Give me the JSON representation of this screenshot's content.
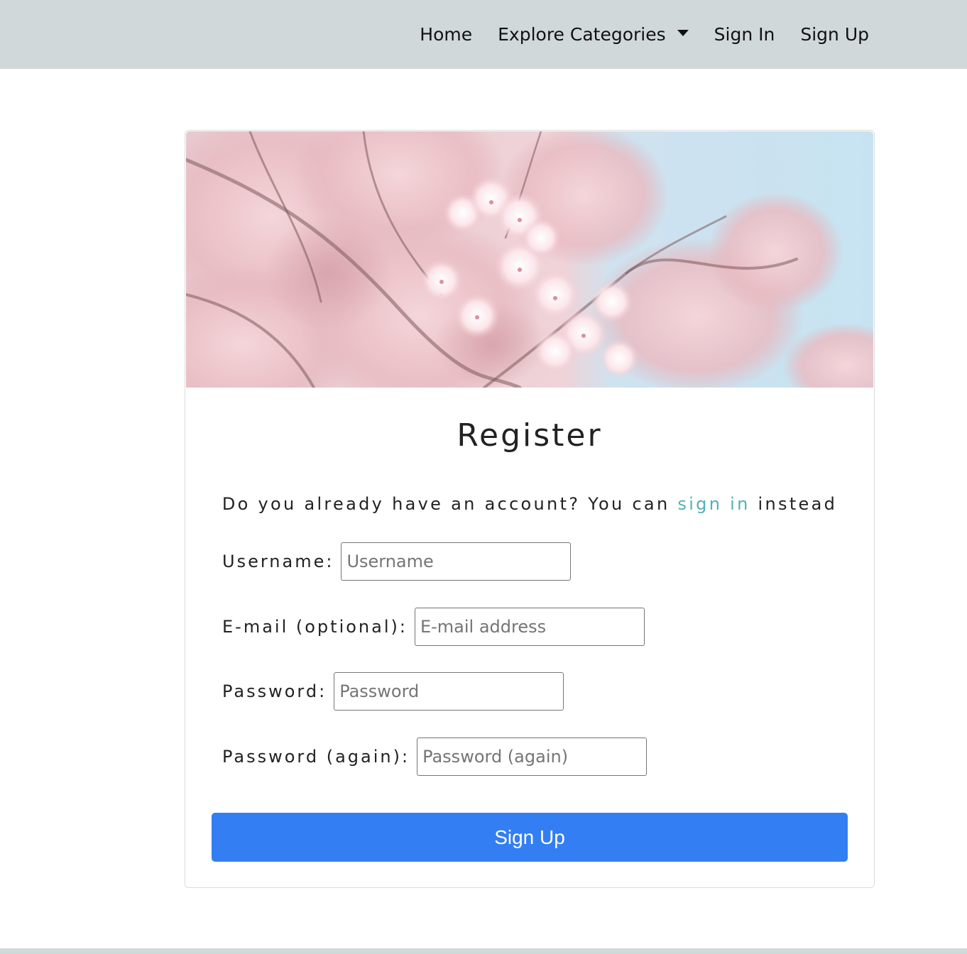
{
  "nav": {
    "items": [
      {
        "label": "Home"
      },
      {
        "label": "Explore Categories"
      },
      {
        "label": "Sign In"
      },
      {
        "label": "Sign Up"
      }
    ]
  },
  "form": {
    "title": "Register",
    "intro_before": "Do you already have an account? You can ",
    "intro_link": "sign in",
    "intro_after": " instead",
    "fields": [
      {
        "label": "Username:",
        "placeholder": "Username",
        "value": ""
      },
      {
        "label": "E-mail (optional):",
        "placeholder": "E-mail address",
        "value": ""
      },
      {
        "label": "Password:",
        "placeholder": "Password",
        "value": ""
      },
      {
        "label": "Password (again):",
        "placeholder": "Password (again)",
        "value": ""
      }
    ],
    "submit_label": "Sign Up"
  },
  "colors": {
    "navbar_bg": "#d1d8da",
    "link_accent": "#4fb1b8",
    "button_primary": "#337ef2"
  },
  "icons": {
    "dropdown": "caret-down-icon"
  }
}
